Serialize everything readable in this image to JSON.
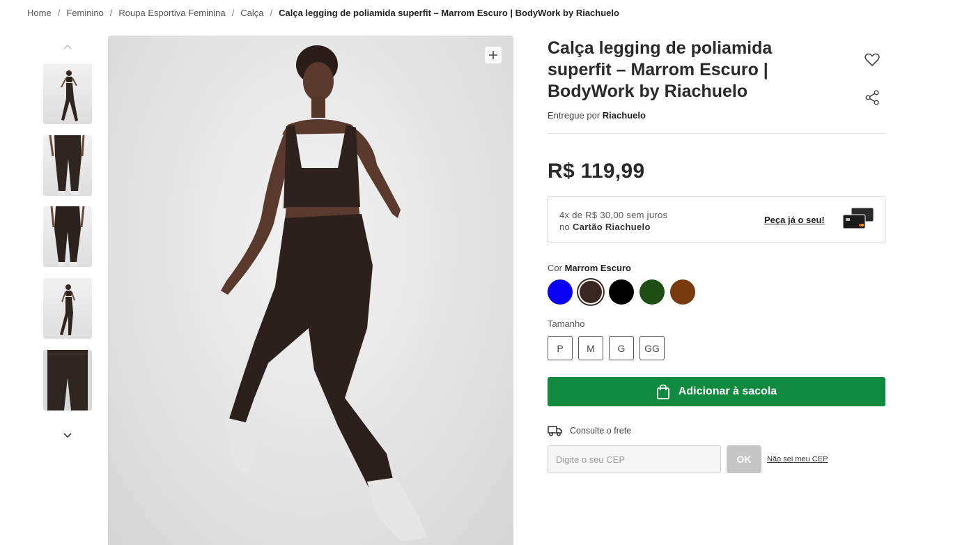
{
  "breadcrumb": {
    "items": [
      "Home",
      "Feminino",
      "Roupa Esportiva Feminina",
      "Calça"
    ],
    "separator": "/",
    "current": "Calça legging de poliamida superfit – Marrom Escuro | BodyWork by Riachuelo"
  },
  "gallery": {
    "thumbnail_count": 5,
    "icons": {
      "up": "chevron-up-icon",
      "down": "chevron-down-icon",
      "zoom": "plus-icon"
    }
  },
  "product": {
    "title": "Calça legging de poliamida superfit – Marrom Escuro | BodyWork by Riachuelo",
    "seller_prefix": "Entregue por",
    "seller_name": "Riachuelo",
    "price": "R$ 119,99",
    "installments_line1": "4x de R$ 30,00 sem juros",
    "installments_line2_prefix": "no",
    "installments_line2_card": "Cartão Riachuelo",
    "card_cta": "Peça já o seu!",
    "color_label": "Cor",
    "selected_color": "Marrom Escuro",
    "colors": [
      {
        "hex": "#0a00f5",
        "selected": false
      },
      {
        "hex": "#3a2620",
        "selected": true
      },
      {
        "hex": "#000000",
        "selected": false
      },
      {
        "hex": "#1e4d16",
        "selected": false
      },
      {
        "hex": "#7a3a10",
        "selected": false
      }
    ],
    "size_label": "Tamanho",
    "sizes": [
      "P",
      "M",
      "G",
      "GG"
    ],
    "add_to_bag": "Adicionar à sacola",
    "freight_label": "Consulte o frete",
    "cep_placeholder": "Digite o seu CEP",
    "ok_label": "OK",
    "no_cep_link": "Não sei meu CEP"
  },
  "colors": {
    "accent_green": "#108a3e",
    "ok_disabled": "#c6c6c6",
    "text_dark": "#2a2a2a"
  }
}
